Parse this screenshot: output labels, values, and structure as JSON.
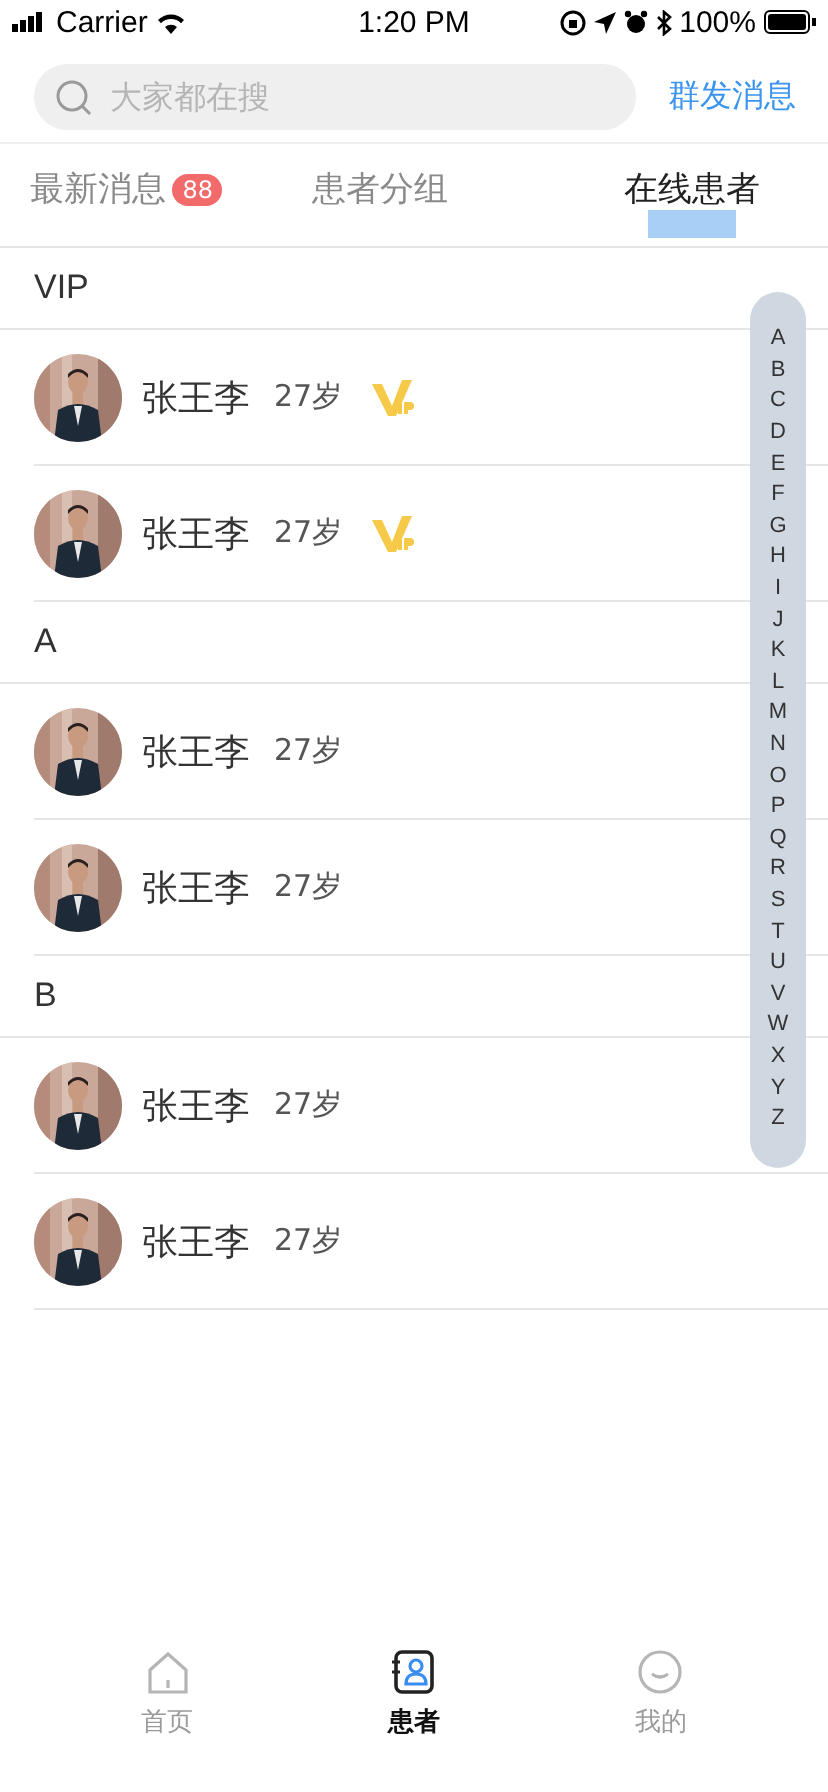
{
  "status_bar": {
    "carrier": "Carrier",
    "time": "1:20 PM",
    "battery": "100%"
  },
  "search": {
    "placeholder": "大家都在搜"
  },
  "header_action": "群发消息",
  "tabs": [
    {
      "label": "最新消息",
      "badge": "88",
      "selected": false
    },
    {
      "label": "患者分组",
      "selected": false
    },
    {
      "label": "在线患者",
      "selected": true
    }
  ],
  "sections": [
    {
      "title": "VIP",
      "patients": [
        {
          "name": "张王李",
          "age": "27岁",
          "vip": true
        },
        {
          "name": "张王李",
          "age": "27岁",
          "vip": true
        }
      ]
    },
    {
      "title": "A",
      "patients": [
        {
          "name": "张王李",
          "age": "27岁",
          "vip": false
        },
        {
          "name": "张王李",
          "age": "27岁",
          "vip": false
        }
      ]
    },
    {
      "title": "B",
      "patients": [
        {
          "name": "张王李",
          "age": "27岁",
          "vip": false
        },
        {
          "name": "张王李",
          "age": "27岁",
          "vip": false
        }
      ]
    }
  ],
  "index_letters": [
    "A",
    "B",
    "C",
    "D",
    "E",
    "F",
    "G",
    "H",
    "I",
    "J",
    "K",
    "L",
    "M",
    "N",
    "O",
    "P",
    "Q",
    "R",
    "S",
    "T",
    "U",
    "V",
    "W",
    "X",
    "Y",
    "Z"
  ],
  "bottom_tabs": [
    {
      "label": "首页",
      "kind": "home",
      "selected": false
    },
    {
      "label": "患者",
      "kind": "contacts",
      "selected": true
    },
    {
      "label": "我的",
      "kind": "smile",
      "selected": false
    }
  ]
}
